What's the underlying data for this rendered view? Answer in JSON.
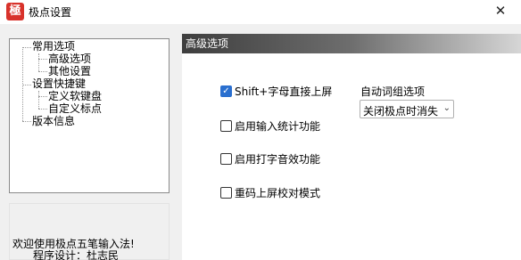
{
  "window": {
    "title": "极点设置",
    "icon_char": "極",
    "close_glyph": "✕"
  },
  "tree": {
    "nodes": [
      {
        "label": "常用选项",
        "level": 0
      },
      {
        "label": "高级选项",
        "level": 1
      },
      {
        "label": "其他设置",
        "level": 1
      },
      {
        "label": "设置快捷键",
        "level": 0
      },
      {
        "label": "定义软键盘",
        "level": 1
      },
      {
        "label": "自定义标点",
        "level": 1
      },
      {
        "label": "版本信息",
        "level": 0
      }
    ]
  },
  "welcome": {
    "line1": "欢迎使用极点五笔输入法!",
    "line2": "程序设计：杜志民"
  },
  "section": {
    "title": "高级选项"
  },
  "options": [
    {
      "label": "Shift+字母直接上屏",
      "checked": true
    },
    {
      "label": "启用输入统计功能",
      "checked": false
    },
    {
      "label": "启用打字音效功能",
      "checked": false
    },
    {
      "label": "重码上屏校对模式",
      "checked": false
    }
  ],
  "auto_group": {
    "label": "自动词组选项",
    "selected": "关闭极点时消失"
  },
  "colors": {
    "accent": "#2a6fcf",
    "header_dark": "#3e3e3e",
    "brand_red": "#d8322b"
  }
}
